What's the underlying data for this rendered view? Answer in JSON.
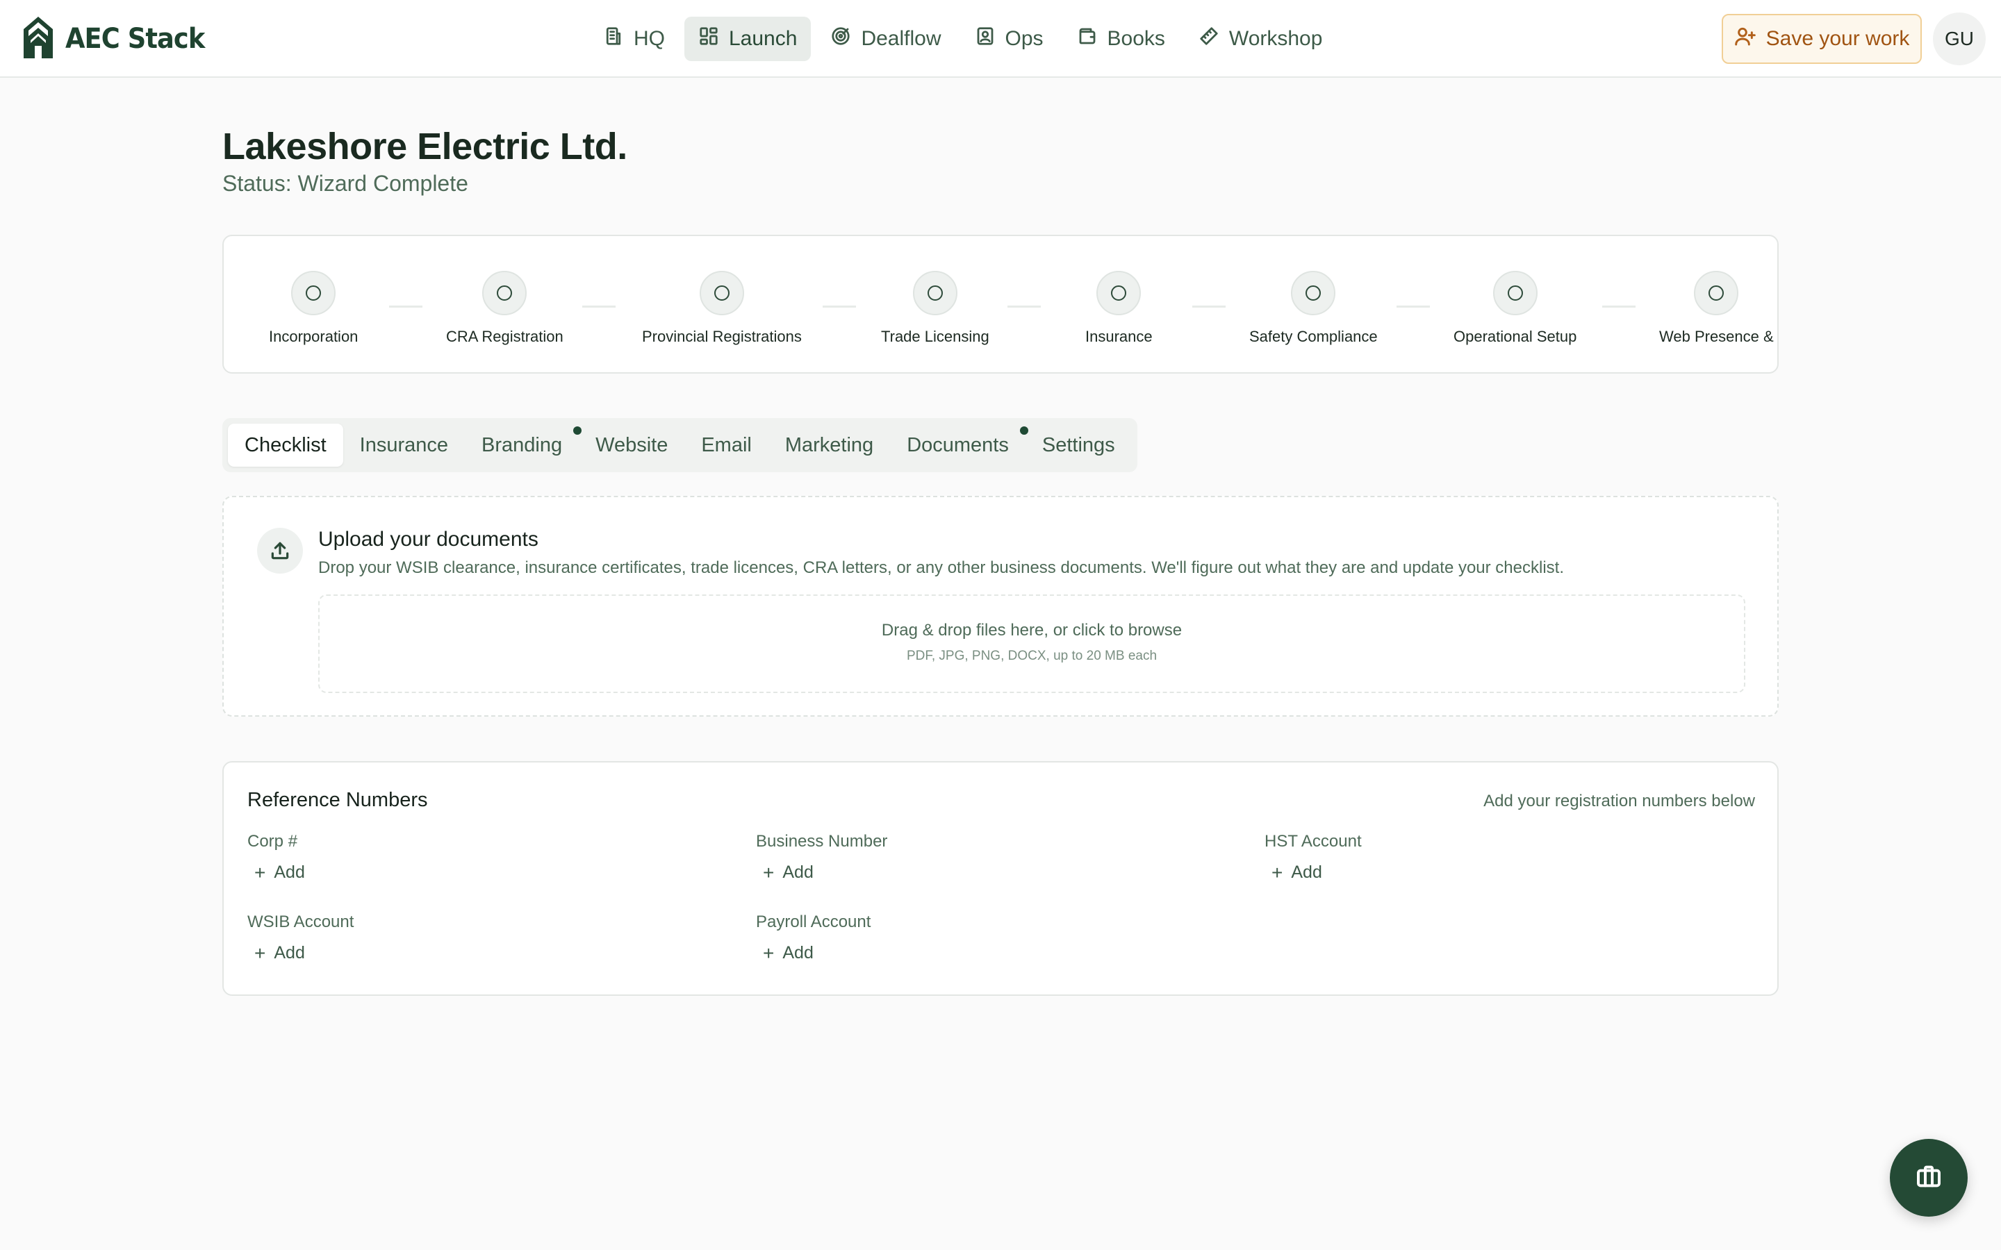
{
  "app": {
    "name": "AEC Stack",
    "logo_icon": "building-logo-icon"
  },
  "nav": {
    "items": [
      {
        "label": "HQ",
        "icon": "building-icon",
        "active": false
      },
      {
        "label": "Launch",
        "icon": "dashboard-icon",
        "active": true
      },
      {
        "label": "Dealflow",
        "icon": "target-icon",
        "active": false
      },
      {
        "label": "Ops",
        "icon": "contact-icon",
        "active": false
      },
      {
        "label": "Books",
        "icon": "wallet-icon",
        "active": false
      },
      {
        "label": "Workshop",
        "icon": "ruler-icon",
        "active": false
      }
    ],
    "save_label": "Save your work",
    "avatar_initials": "GU"
  },
  "header": {
    "title": "Lakeshore Electric Ltd.",
    "status": "Status: Wizard Complete"
  },
  "stepper": {
    "steps": [
      {
        "label": "Incorporation"
      },
      {
        "label": "CRA Registration"
      },
      {
        "label": "Provincial Registrations"
      },
      {
        "label": "Trade Licensing"
      },
      {
        "label": "Insurance"
      },
      {
        "label": "Safety Compliance"
      },
      {
        "label": "Operational Setup"
      },
      {
        "label": "Web Presence &"
      }
    ]
  },
  "tabs": [
    {
      "label": "Checklist",
      "active": true,
      "dot": false
    },
    {
      "label": "Insurance",
      "active": false,
      "dot": false
    },
    {
      "label": "Branding",
      "active": false,
      "dot": true
    },
    {
      "label": "Website",
      "active": false,
      "dot": false
    },
    {
      "label": "Email",
      "active": false,
      "dot": false
    },
    {
      "label": "Marketing",
      "active": false,
      "dot": false
    },
    {
      "label": "Documents",
      "active": false,
      "dot": true
    },
    {
      "label": "Settings",
      "active": false,
      "dot": false
    }
  ],
  "upload": {
    "title": "Upload your documents",
    "description": "Drop your WSIB clearance, insurance certificates, trade licences, CRA letters, or any other business documents. We'll figure out what they are and update your checklist.",
    "dropzone_main": "Drag & drop files here, or click to browse",
    "dropzone_sub": "PDF, JPG, PNG, DOCX, up to 20 MB each"
  },
  "references": {
    "title": "Reference Numbers",
    "hint": "Add your registration numbers below",
    "add_label": "Add",
    "fields": [
      {
        "label": "Corp #"
      },
      {
        "label": "Business Number"
      },
      {
        "label": "HST Account"
      },
      {
        "label": "WSIB Account"
      },
      {
        "label": "Payroll Account"
      }
    ]
  },
  "colors": {
    "brand": "#1f4330",
    "fab": "#244a35",
    "save_accent": "#a05412",
    "background": "#fafafa"
  }
}
